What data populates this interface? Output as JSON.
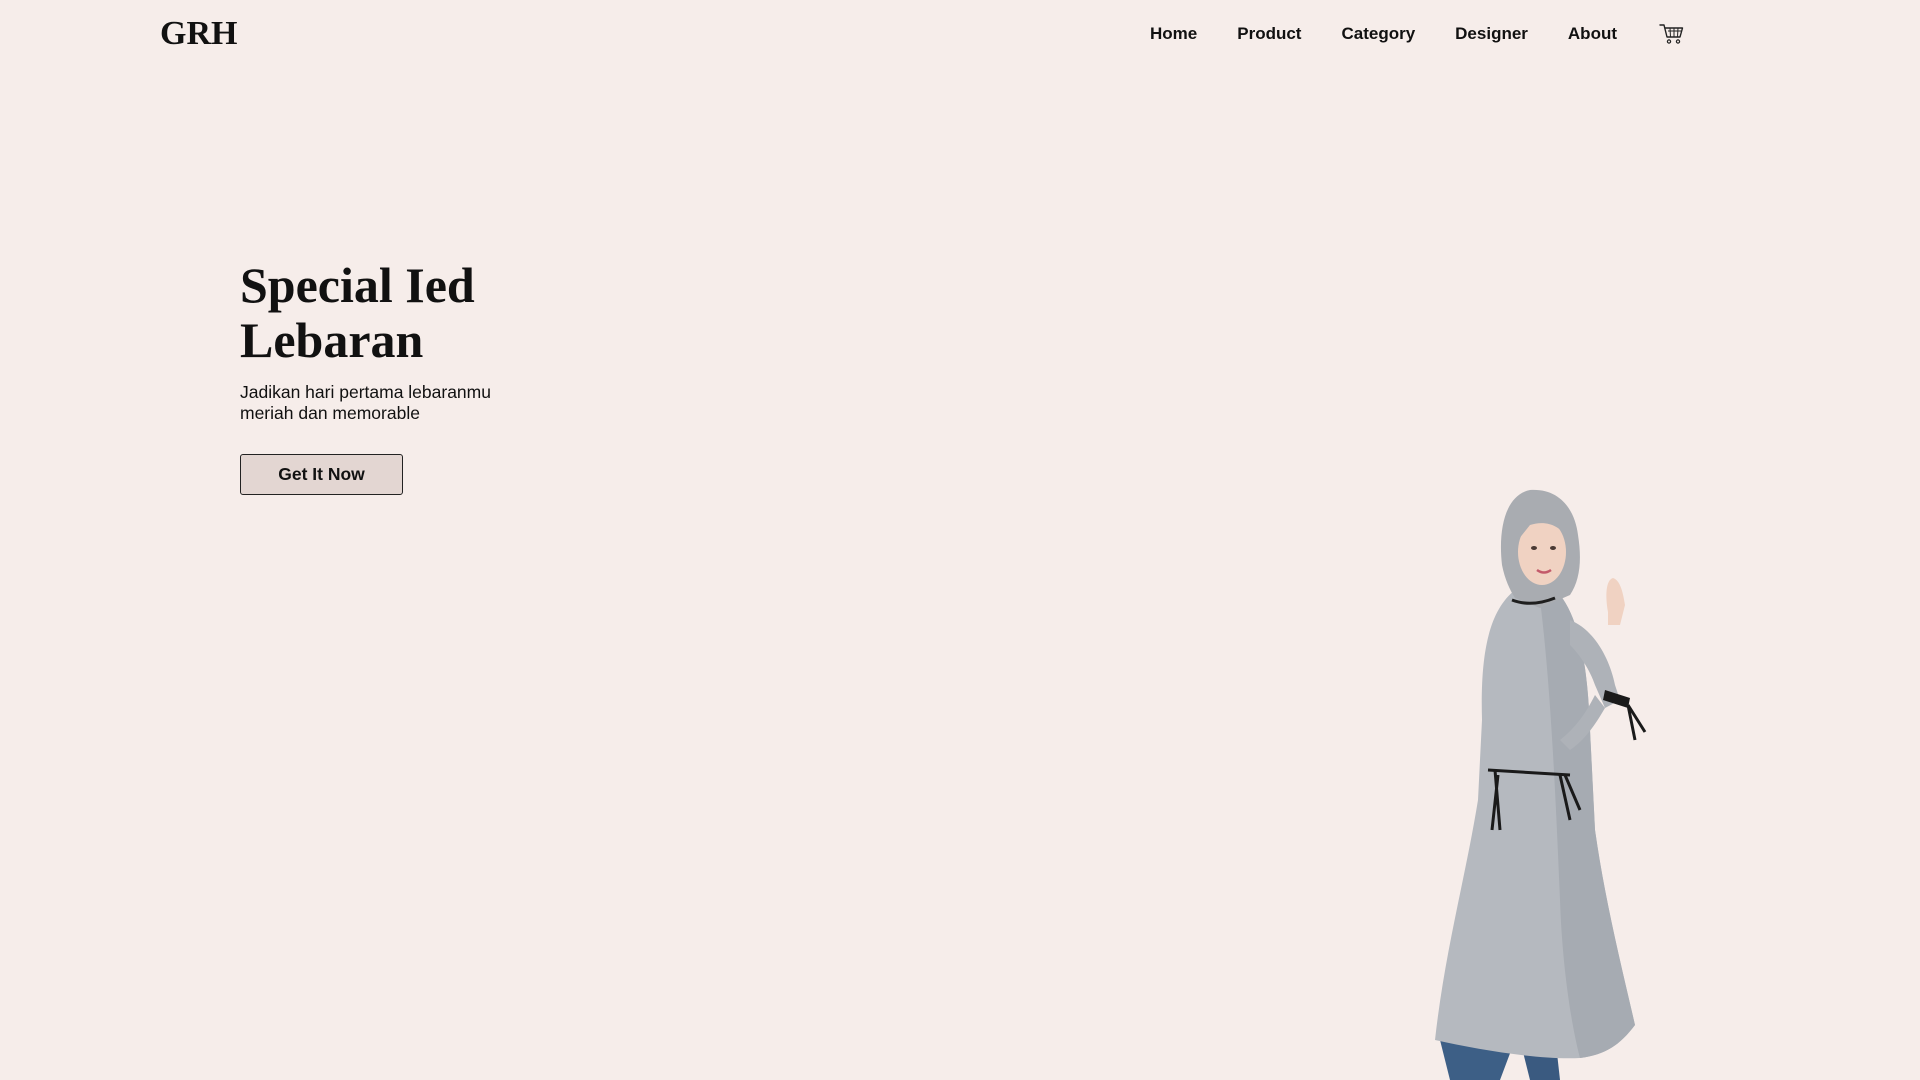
{
  "header": {
    "logo": "GRH",
    "nav": [
      "Home",
      "Product",
      "Category",
      "Designer",
      "About"
    ],
    "cart_icon": "cart-icon"
  },
  "hero": {
    "title_line1": "Special Ied",
    "title_line2": "Lebaran",
    "subtitle": "Jadikan hari pertama lebaranmu meriah dan memorable",
    "cta_label": "Get It Now"
  },
  "colors": {
    "background": "#f6edea",
    "button_bg": "#e3d6d2",
    "text": "#111111"
  }
}
